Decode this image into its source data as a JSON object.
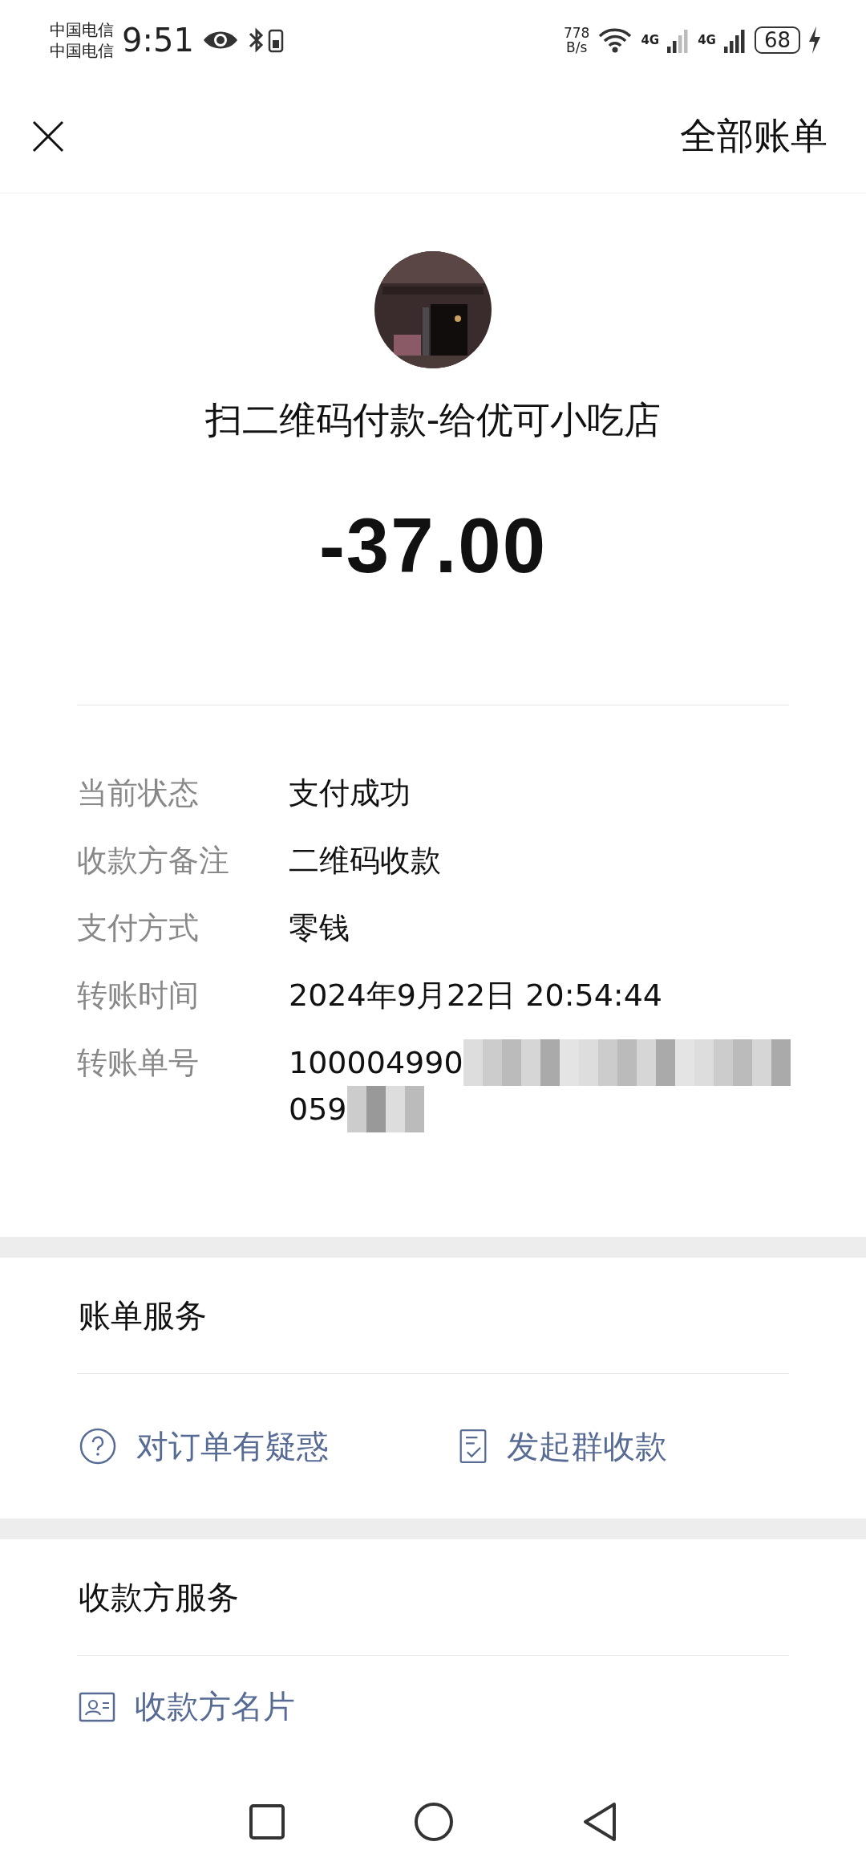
{
  "status_bar": {
    "carriers": [
      "中国电信",
      "中国电信"
    ],
    "time": "9:51",
    "speed": [
      "778",
      "B/s"
    ],
    "networks": [
      "4G",
      "4G"
    ],
    "battery": "68"
  },
  "header": {
    "title": "全部账单"
  },
  "payment": {
    "merchant": "扫二维码付款-给优可小吃店",
    "amount": "-37.00"
  },
  "details": [
    {
      "label": "当前状态",
      "value": [
        "支付成功"
      ]
    },
    {
      "label": "收款方备注",
      "value": [
        "二维码收款"
      ]
    },
    {
      "label": "支付方式",
      "value": [
        "零钱"
      ]
    },
    {
      "label": "转账时间",
      "value": [
        "2024年9月22日 20:54:44"
      ]
    },
    {
      "label": "转账单号",
      "value": [
        "100004990",
        "059"
      ],
      "redacted": true
    }
  ],
  "sections": [
    {
      "title": "账单服务",
      "actions": [
        {
          "kind": "question",
          "label": "对订单有疑惑"
        },
        {
          "kind": "checklist",
          "label": "发起群收款"
        }
      ]
    },
    {
      "title": "收款方服务",
      "actions": [
        {
          "kind": "card",
          "label": "收款方名片"
        }
      ]
    }
  ]
}
